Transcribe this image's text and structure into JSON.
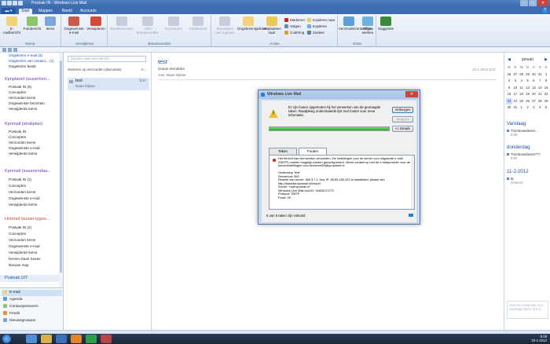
{
  "window": {
    "title": "Postvak IN - Windows Live Mail",
    "file_button": "",
    "tabs": [
      "Start",
      "Mappen",
      "Beeld",
      "Accounts"
    ],
    "controls": [
      "–",
      "□",
      "✕"
    ]
  },
  "ribbon": {
    "groups": {
      "nieuw": {
        "label": "Nieuw",
        "buttons": [
          "E-mailbericht",
          "Fotobericht",
          "Items"
        ]
      },
      "verwijderen": {
        "label": "Verwijderen",
        "buttons": [
          "Ongewenste e-mail",
          "Verwijderen"
        ]
      },
      "beantwoorden": {
        "label": "Beantwoorden",
        "buttons": [
          "Beantwoorden",
          "Allen beantwoorden",
          "Doorsturen",
          "Chatbericht"
        ]
      },
      "acties": {
        "label": "Acties",
        "buttons": [
          "Toevoegen aan agenda",
          "Ongelezen/gelezen",
          "Verplaatsen naar"
        ],
        "small": [
          "Markeren",
          "Volgen",
          "Codering",
          "Kopiëren naar",
          "Kopiëren",
          "Zoeken"
        ]
      },
      "extra": {
        "label": "Extra",
        "buttons": [
          "Verzenden/ontvangen",
          "Offline werken"
        ]
      },
      "suggesties": {
        "buttons": [
          "Suggestie"
        ]
      }
    }
  },
  "folders": {
    "top": [
      "Ongelezen e-mail (3)",
      "Ongelezen van contact... (1)",
      "Ongelezen feeds"
    ],
    "accounts": [
      {
        "name": "Kpnplanet (susanhen...",
        "color": "purple",
        "items": [
          "Postvak IN (6)",
          "Concepten",
          "Verzonden items",
          "Ongewenste berichten",
          "Verwijderde items"
        ]
      },
      {
        "name": "Kpnmail (strakplan)",
        "color": "purple",
        "items": [
          "Postvak IN",
          "Concepten",
          "Verzonden items",
          "Ongewenste e-mail",
          "Verwijderde items"
        ]
      },
      {
        "name": "Kpnmail (susanendaa...",
        "color": "purple",
        "items": [
          "Postvak IN (1)",
          "Concepten",
          "Verzonden items",
          "Ongewenste e-mail",
          "Verwijderde items"
        ]
      },
      {
        "name": "Hotmail (susan-tygoo...",
        "color": "red",
        "items": [
          "Postvak IN (2)",
          "Concepten",
          "Verzonden items",
          "Ongewenste e-mail",
          "Verwijderde items",
          "breven Daan Susan",
          "Nieuwe map"
        ]
      }
    ],
    "outbox": "Postvak UIT"
  },
  "nav": [
    "E-mail",
    "Agenda",
    "Contactpersonen",
    "Feeds",
    "Nieuwsgroepen"
  ],
  "msglist": {
    "search_placeholder": "Zoeken naar een bericht",
    "sort_label": "Sorteren op verzonden (discussie)",
    "sort_dir": "A ↓",
    "messages": [
      {
        "subject": "test",
        "from": "Daan Nijsse",
        "date": "9:27"
      }
    ]
  },
  "reading": {
    "subject": "test",
    "sender": "Susan Hendriks",
    "to_label": "Aan:",
    "to": "Daan Nijsse",
    "date": "23-1-2012 9:27"
  },
  "calendar": {
    "month": "januari",
    "prev": "◀",
    "next": "▶",
    "dow": [
      "M",
      "D",
      "W",
      "D",
      "V",
      "Z",
      "Z"
    ],
    "weeks": [
      [
        "26",
        "27",
        "28",
        "29",
        "30",
        "31",
        "1"
      ],
      [
        "2",
        "3",
        "4",
        "5",
        "6",
        "7",
        "8"
      ],
      [
        "9",
        "10",
        "11",
        "12",
        "13",
        "14",
        "15"
      ],
      [
        "16",
        "17",
        "18",
        "19",
        "20",
        "21",
        "22"
      ],
      [
        "23",
        "24",
        "25",
        "26",
        "27",
        "28",
        "29"
      ],
      [
        "30",
        "31",
        "1",
        "2",
        "3",
        "4",
        "5"
      ]
    ],
    "today_label": "Vandaag",
    "today_events": [
      {
        "title": "Trombosedienst...",
        "time": "9:00"
      }
    ],
    "tomorrow_label": "donderdag",
    "tomorrow_events": [
      {
        "title": "Trombosedienst???",
        "time": "9:00"
      }
    ],
    "date_label": "11-2-2012",
    "date_events": [
      {
        "title": "ttt",
        "sub": "(Hanen)"
      }
    ],
    "new_event_placeholder": "Snel een afspraak voor vandaag typen (23-1)"
  },
  "taskbar": {
    "time": "9:29",
    "date": "23-1-2012"
  },
  "dialog": {
    "title": "Windows Live Mail",
    "close": "✕",
    "message": "Er zijn fouten opgetreden bij het verwerken van de gevraagde taken. Raadpleeg onderstaande lijst met fouten voor meer informatie.",
    "buttons": {
      "hide": "Verbergen",
      "stop": "Stoppen",
      "details": "<< Details"
    },
    "progress": 1.0,
    "tabs": [
      "Taken",
      "Fouten"
    ],
    "error_text": "Het bericht kan niet worden verzonden. De instellingen voor de server voor uitgaande e-mail (SMTP) moeten mogelijk worden geconfigureerd. Neem contact op met de e-mailprovider voor de serverinstellingen voor dnesmnr09@kpnplanet.nl.\n\nOnderwerp 'test'\nServerfout: 550\nReactie van server: 550 5.7.1 Your IP: 86.83.184.101 is blacklisted, please see http://blacklist.kpnmail.nl/help/4\nServer: 'mail.kpnmail.nl'\nWindows Live Mail-fout-ID: 0x800CCC79\nProtocol: SMTP\nPoort: 25",
    "status": "5 van 6 taken zijn voltooid"
  }
}
